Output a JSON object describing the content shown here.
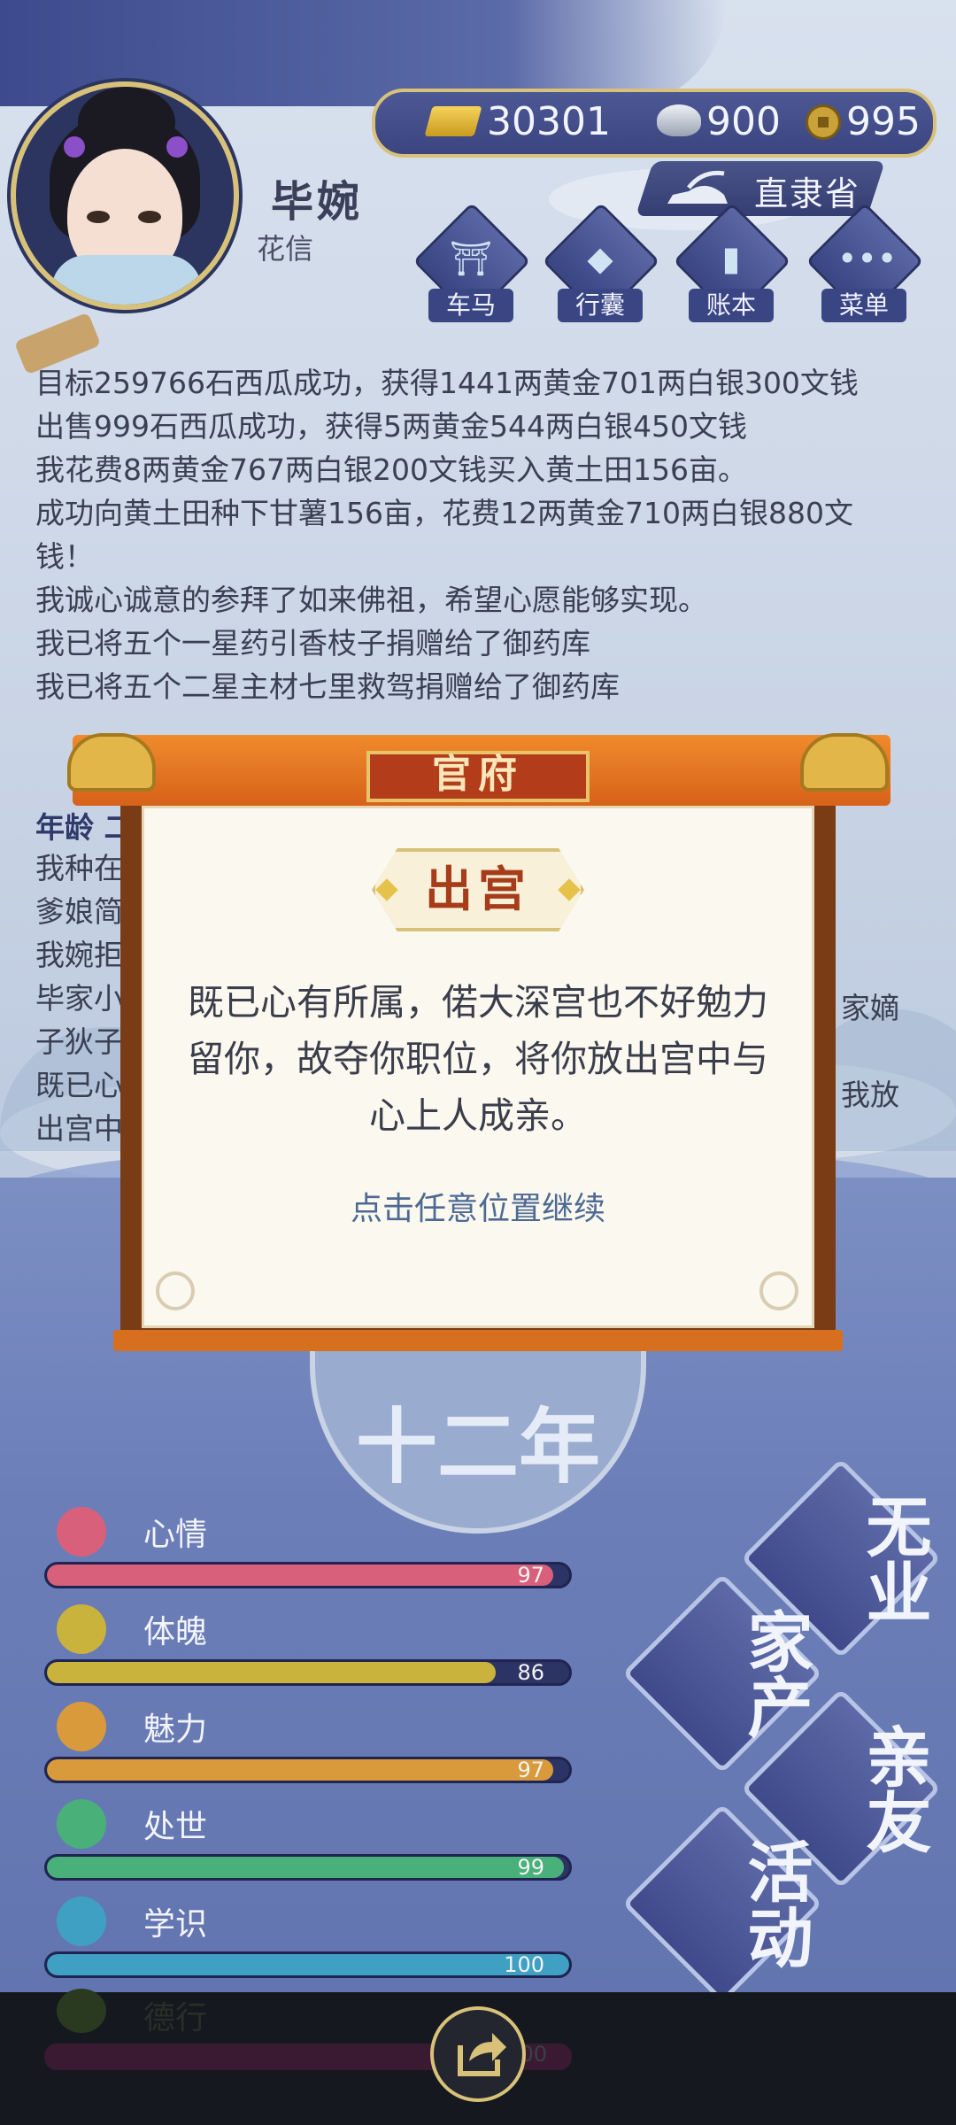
{
  "header": {
    "player_name": "毕婉",
    "player_title": "花信",
    "currency": {
      "gold": "30301",
      "silver": "900",
      "coins": "995"
    },
    "province": "直隶省",
    "menu": [
      {
        "label": "车马",
        "icon": "carriage-icon"
      },
      {
        "label": "行囊",
        "icon": "bag-icon"
      },
      {
        "label": "账本",
        "icon": "ledger-icon"
      },
      {
        "label": "菜单",
        "icon": "more-icon"
      }
    ]
  },
  "log": {
    "lines": [
      "目标259766石西瓜成功，获得1441两黄金701两白银300文钱",
      "出售999石西瓜成功，获得5两黄金544两白银450文钱",
      "我花费8两黄金767两白银200文钱买入黄土田156亩。",
      "成功向黄土田种下甘薯156亩，花费12两黄金710两白银880文",
      "钱！",
      "我诚心诚意的参拜了如来佛祖，希望心愿能够实现。",
      "我已将五个一星药引香枝子捐赠给了御药库",
      "我已将五个二星主材七里救驾捐赠给了御药库"
    ],
    "age_label": "年龄 二",
    "partial_lines": [
      "我种在",
      "爹娘简",
      "我婉拒",
      "毕家小",
      "子狄子",
      "既已心",
      "出宫中"
    ],
    "partial_right": [
      "家嫡",
      "我放"
    ]
  },
  "modal": {
    "banner": "官府",
    "heading": "出宫",
    "message": "既已心有所属，偌大深宫也不好勉力留你，故夺你职位，将你放出宫中与心上人成亲。",
    "continue_hint": "点击任意位置继续"
  },
  "emblem": {
    "text": "十二年"
  },
  "stats": [
    {
      "label": "心情",
      "value": 97,
      "value_text": "97",
      "color": "#d9607a",
      "icon": "flower-icon"
    },
    {
      "label": "体魄",
      "value": 86,
      "value_text": "86",
      "color": "#c9b33c",
      "icon": "lantern-icon"
    },
    {
      "label": "魅力",
      "value": 97,
      "value_text": "97",
      "color": "#d99a3c",
      "icon": "jade-icon"
    },
    {
      "label": "处世",
      "value": 99,
      "value_text": "99",
      "color": "#4ab07a",
      "icon": "fan-icon"
    },
    {
      "label": "学识",
      "value": 100,
      "value_text": "100",
      "color": "#3fa0c4",
      "icon": "books-icon"
    }
  ],
  "dimmed_stat": {
    "label": "德行",
    "value_text": "100"
  },
  "actions": [
    {
      "label": "无业"
    },
    {
      "label": "家产"
    },
    {
      "label": "亲友"
    },
    {
      "label": "活动"
    }
  ],
  "colors": {
    "accent_gold": "#d8c27a",
    "ribbon_orange": "#e57a24",
    "frame_brown": "#7a3c15",
    "heading_red": "#a63c1a",
    "link_blue": "#4d6a92"
  }
}
